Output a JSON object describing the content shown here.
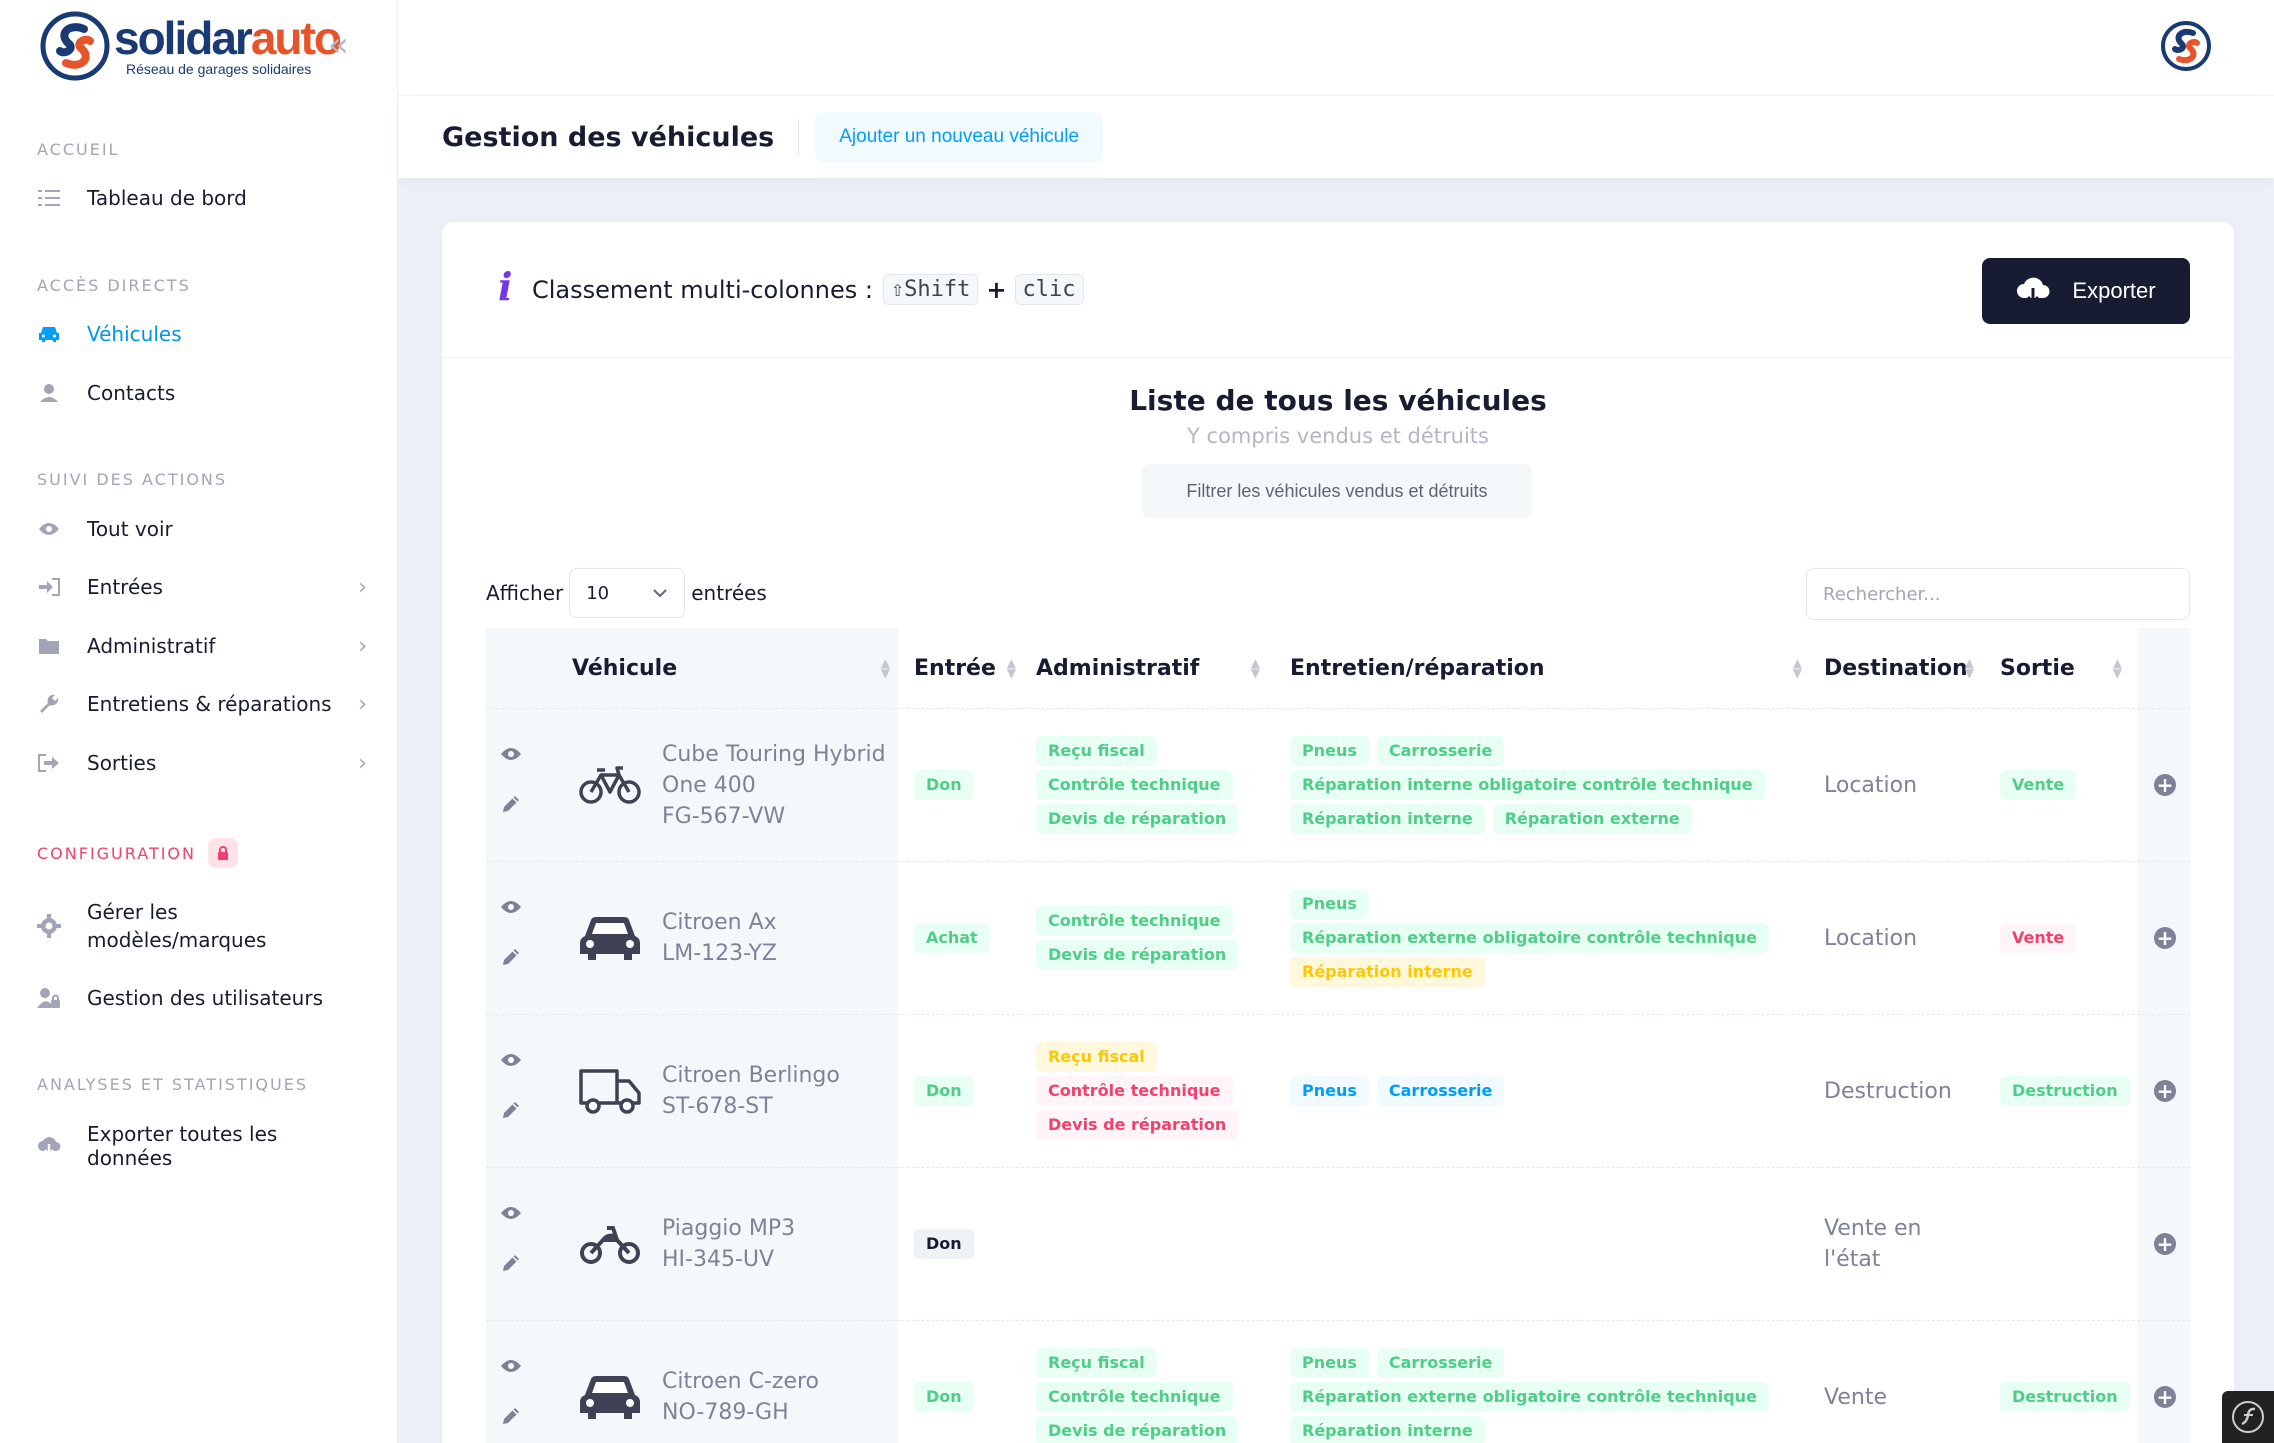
{
  "brand": {
    "name_a": "solidar",
    "name_b": "auto",
    "tagline": "Réseau de garages solidaires",
    "color_blue": "#1a3a73",
    "color_orange": "#e8542a"
  },
  "sidebar": {
    "collapse_glyph": "«",
    "sections": [
      "ACCUEIL",
      "ACCÈS DIRECTS",
      "SUIVI DES ACTIONS",
      "CONFIGURATION",
      "ANALYSES ET STATISTIQUES"
    ],
    "items": [
      {
        "label": "Tableau de bord",
        "icon": "list-icon"
      },
      {
        "label": "Véhicules",
        "icon": "car-icon",
        "active": true
      },
      {
        "label": "Contacts",
        "icon": "contact-icon"
      },
      {
        "label": "Tout voir",
        "icon": "eye-icon"
      },
      {
        "label": "Entrées",
        "icon": "sign-in-icon"
      },
      {
        "label": "Administratif",
        "icon": "folder-icon"
      },
      {
        "label": "Entretiens & réparations",
        "icon": "wrench-icon"
      },
      {
        "label": "Sorties",
        "icon": "sign-out-icon"
      },
      {
        "label_line1": "Gérer les",
        "label_line2": "modèles/marques",
        "icon": "gear-icon"
      },
      {
        "label": "Gestion des utilisateurs",
        "icon": "user-lock-icon"
      },
      {
        "label": "Exporter toutes les données",
        "icon": "cloud-download-icon"
      }
    ],
    "chevron": "›"
  },
  "header": {
    "title": "Gestion des véhicules",
    "add_label": "Ajouter un nouveau véhicule"
  },
  "card": {
    "info_glyph": "i",
    "multi_label": "Classement multi-colonnes :",
    "key_shift": "⇧Shift",
    "key_plus": "+",
    "key_click": "clic",
    "export_label": "Exporter",
    "list_title": "Liste de tous les véhicules",
    "list_subtitle": "Y compris vendus et détruits",
    "filter_label": "Filtrer les véhicules vendus et détruits",
    "show_label": "Afficher",
    "show_value": "10",
    "entries_label": "entrées",
    "search_placeholder": "Rechercher..."
  },
  "table": {
    "headers": [
      "Véhicule",
      "Entrée",
      "Administratif",
      "Entretien/réparation",
      "Destination",
      "Sortie"
    ],
    "rows": [
      {
        "vehicle_icon": "bicycle-icon",
        "lines": [
          "Cube Touring Hybrid",
          "One 400",
          "FG-567-VW"
        ],
        "entree": {
          "text": "Don",
          "tone": "green"
        },
        "admin": [
          {
            "text": "Reçu fiscal",
            "tone": "green"
          },
          {
            "text": "Contrôle technique",
            "tone": "green"
          },
          {
            "text": "Devis de réparation",
            "tone": "green"
          }
        ],
        "repair": [
          {
            "text": "Pneus",
            "tone": "green"
          },
          {
            "text": "Carrosserie",
            "tone": "green"
          },
          {
            "text": "Réparation interne obligatoire contrôle technique",
            "tone": "green"
          },
          {
            "text": "Réparation interne",
            "tone": "green"
          },
          {
            "text": "Réparation externe",
            "tone": "green"
          }
        ],
        "destination": [
          "Location"
        ],
        "sortie": {
          "text": "Vente",
          "tone": "green"
        }
      },
      {
        "vehicle_icon": "car-icon",
        "lines": [
          "Citroen Ax",
          "LM-123-YZ"
        ],
        "entree": {
          "text": "Achat",
          "tone": "green"
        },
        "admin": [
          {
            "text": "Contrôle technique",
            "tone": "green"
          },
          {
            "text": "Devis de réparation",
            "tone": "green"
          }
        ],
        "repair": [
          {
            "text": "Pneus",
            "tone": "green"
          },
          {
            "text": "Réparation externe obligatoire contrôle technique",
            "tone": "green"
          },
          {
            "text": "Réparation interne",
            "tone": "yellow"
          }
        ],
        "destination": [
          "Location"
        ],
        "sortie": {
          "text": "Vente",
          "tone": "red"
        }
      },
      {
        "vehicle_icon": "truck-icon",
        "lines": [
          "Citroen Berlingo",
          "ST-678-ST"
        ],
        "entree": {
          "text": "Don",
          "tone": "green"
        },
        "admin": [
          {
            "text": "Reçu fiscal",
            "tone": "yellow"
          },
          {
            "text": "Contrôle technique",
            "tone": "red"
          },
          {
            "text": "Devis de réparation",
            "tone": "red"
          }
        ],
        "repair": [
          {
            "text": "Pneus",
            "tone": "blue"
          },
          {
            "text": "Carrosserie",
            "tone": "blue"
          }
        ],
        "destination": [
          "Destruction"
        ],
        "sortie": {
          "text": "Destruction",
          "tone": "green"
        }
      },
      {
        "vehicle_icon": "motorcycle-icon",
        "lines": [
          "Piaggio MP3",
          "HI-345-UV"
        ],
        "entree": {
          "text": "Don",
          "tone": "dark"
        },
        "admin": [],
        "repair": [],
        "destination": [
          "Vente en",
          "l'état"
        ],
        "sortie": null
      },
      {
        "vehicle_icon": "car-icon",
        "lines": [
          "Citroen C-zero",
          "NO-789-GH"
        ],
        "entree": {
          "text": "Don",
          "tone": "green"
        },
        "admin": [
          {
            "text": "Reçu fiscal",
            "tone": "green"
          },
          {
            "text": "Contrôle technique",
            "tone": "green"
          },
          {
            "text": "Devis de réparation",
            "tone": "green"
          }
        ],
        "repair": [
          {
            "text": "Pneus",
            "tone": "green"
          },
          {
            "text": "Carrosserie",
            "tone": "green"
          },
          {
            "text": "Réparation externe obligatoire contrôle technique",
            "tone": "green"
          },
          {
            "text": "Réparation interne",
            "tone": "green"
          }
        ],
        "destination": [
          "Vente"
        ],
        "sortie": {
          "text": "Destruction",
          "tone": "green"
        }
      }
    ]
  }
}
